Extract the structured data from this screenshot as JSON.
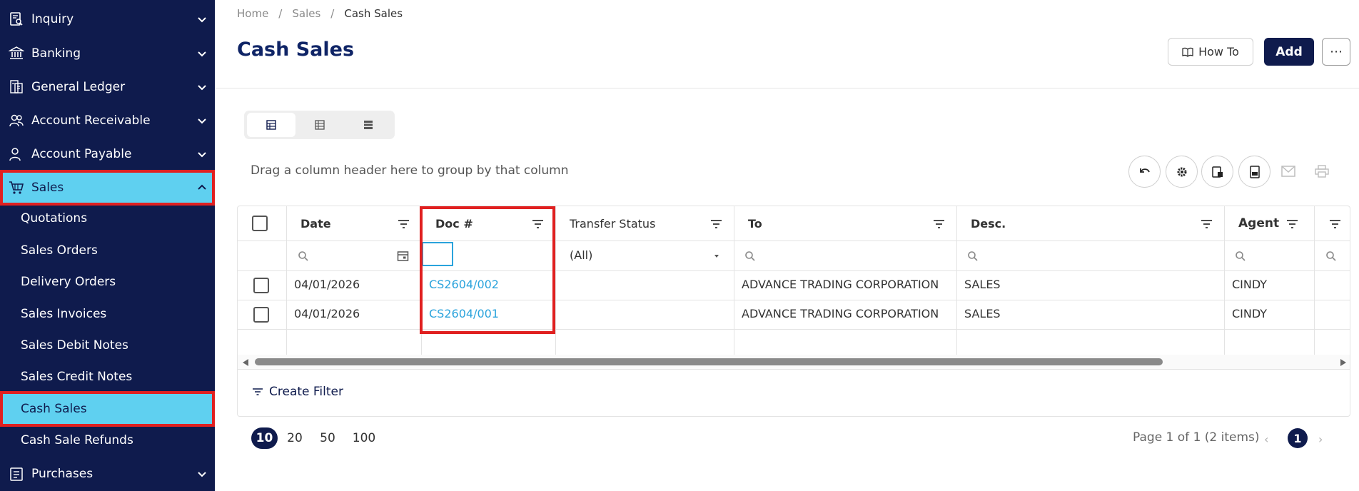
{
  "sidebar": {
    "items": [
      {
        "label": "Inquiry",
        "icon": "inquiry-icon"
      },
      {
        "label": "Banking",
        "icon": "bank-icon"
      },
      {
        "label": "General Ledger",
        "icon": "ledger-icon"
      },
      {
        "label": "Account Receivable",
        "icon": "receivable-icon"
      },
      {
        "label": "Account Payable",
        "icon": "payable-icon"
      },
      {
        "label": "Sales",
        "icon": "cart-icon"
      },
      {
        "label": "Purchases",
        "icon": "purchases-icon"
      }
    ],
    "sales_subitems": [
      "Quotations",
      "Sales Orders",
      "Delivery Orders",
      "Sales Invoices",
      "Sales Debit Notes",
      "Sales Credit Notes",
      "Cash Sales",
      "Cash Sale Refunds"
    ]
  },
  "breadcrumb": {
    "home": "Home",
    "sales": "Sales",
    "current": "Cash Sales",
    "separator": "/"
  },
  "page": {
    "title": "Cash Sales"
  },
  "header": {
    "howto_label": "How To",
    "add_label": "Add",
    "more_label": "⋯"
  },
  "toolbar": {
    "group_hint": "Drag a column header here to group by that column"
  },
  "grid": {
    "columns": [
      "Date",
      "Doc #",
      "Transfer Status",
      "To",
      "Desc.",
      "Agent"
    ],
    "transfer_status_filter": "(All)",
    "rows": [
      {
        "date": "04/01/2026",
        "doc": "CS2604/002",
        "transfer_status": "",
        "to": "ADVANCE TRADING CORPORATION",
        "desc": "SALES",
        "agent": "CINDY"
      },
      {
        "date": "04/01/2026",
        "doc": "CS2604/001",
        "transfer_status": "",
        "to": "ADVANCE TRADING CORPORATION",
        "desc": "SALES",
        "agent": "CINDY"
      }
    ],
    "create_filter_label": "Create Filter"
  },
  "pager": {
    "sizes": [
      "10",
      "20",
      "50",
      "100"
    ],
    "active_size": "10",
    "info": "Page 1 of 1 (2 items)",
    "prev": "‹",
    "next": "›",
    "current_page": "1"
  },
  "colors": {
    "sidebar_bg": "#0f1b4d",
    "active_bg": "#5fd0f0",
    "highlight": "#e02020",
    "link": "#2aa3dc",
    "title": "#0f2466"
  }
}
